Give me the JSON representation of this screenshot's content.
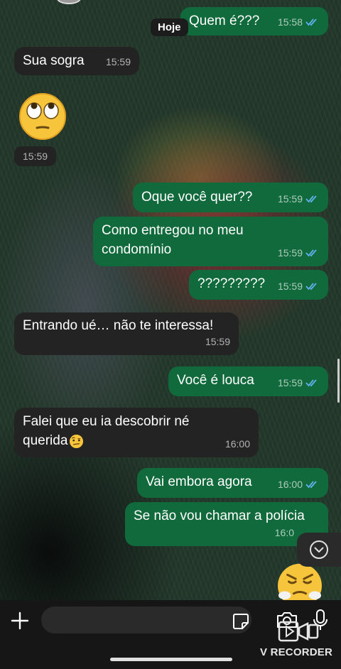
{
  "chat": {
    "date_chip": "Hoje",
    "messages": [
      {
        "text": "Quem é???",
        "time": "15:58"
      },
      {
        "text": "Sua sogra",
        "time": "15:59"
      },
      {
        "emoji": "face-with-rolling-eyes",
        "time": "15:59"
      },
      {
        "text": "Oque você quer??",
        "time": "15:59"
      },
      {
        "line1": "Como entregou no meu",
        "line2": "condomínio",
        "time": "15:59"
      },
      {
        "text": "?????????",
        "time": "15:59"
      },
      {
        "text": "Entrando ué… não te interessa!",
        "time": "15:59"
      },
      {
        "text": "Você é louca",
        "time": "15:59"
      },
      {
        "line1": "Falei que eu ia descobrir né",
        "line2": "querida",
        "emoji": "face-with-raised-eyebrow",
        "time": "16:00"
      },
      {
        "text": "Vai embora agora",
        "time": "16:00"
      },
      {
        "text": "Se não vou chamar a polícia",
        "time": "16:0"
      },
      {
        "emoji": "face-with-steam-from-nose"
      }
    ]
  },
  "composer": {
    "input_value": "",
    "icons": [
      "plus-icon",
      "sticker-icon",
      "camera-icon",
      "microphone-icon"
    ]
  },
  "watermark": {
    "text": "V RECORDER"
  },
  "colors": {
    "outgoing_bubble": "#116a3c",
    "incoming_bubble": "#232323",
    "read_ticks": "#5fb0ea"
  }
}
